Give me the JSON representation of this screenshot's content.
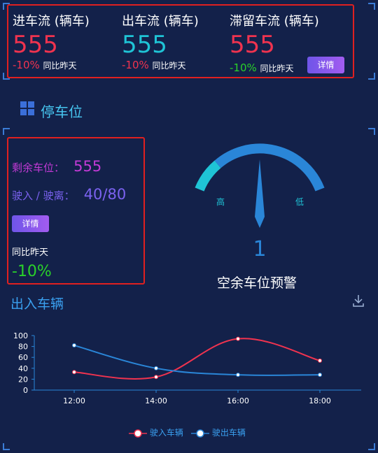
{
  "stats": {
    "inflow": {
      "title": "进车流 (辆车)",
      "value": "555",
      "pct": "-10%",
      "cmp": "同比昨天",
      "value_color": "#f0334f",
      "pct_color": "#f0334f"
    },
    "outflow": {
      "title": "出车流 (辆车)",
      "value": "555",
      "pct": "-10%",
      "cmp": "同比昨天",
      "value_color": "#1fc4d6",
      "pct_color": "#f0334f"
    },
    "retained": {
      "title": "滞留车流 (辆车)",
      "value": "555",
      "pct": "-10%",
      "cmp": "同比昨天",
      "value_color": "#f0334f",
      "pct_color": "#2ad12a"
    },
    "detail_label": "详情"
  },
  "parking": {
    "section_title": "停车位",
    "remaining_label": "剩余车位：",
    "remaining_value": "555",
    "in_out_label": "驶入 / 驶离：",
    "in_out_value": "40/80",
    "detail_label": "详情",
    "cmp_label": "同比昨天",
    "cmp_value": "-10%"
  },
  "gauge": {
    "high_label": "高",
    "low_label": "低",
    "value": "1",
    "title": "空余车位预警",
    "arc_colors": [
      "#1fc4d6",
      "#2a86d8"
    ]
  },
  "flow": {
    "title": "出入车辆"
  },
  "chart_data": {
    "type": "line",
    "categories": [
      "12:00",
      "14:00",
      "16:00",
      "18:00"
    ],
    "ylim": [
      0,
      100
    ],
    "yticks": [
      0,
      20,
      40,
      60,
      80,
      100
    ],
    "series": [
      {
        "name": "驶入车辆",
        "values": [
          33,
          24,
          94,
          54
        ],
        "color": "#f0334f"
      },
      {
        "name": "驶出车辆",
        "values": [
          82,
          40,
          28,
          28
        ],
        "color": "#2a86d8"
      }
    ],
    "legend": "bottom-center"
  }
}
